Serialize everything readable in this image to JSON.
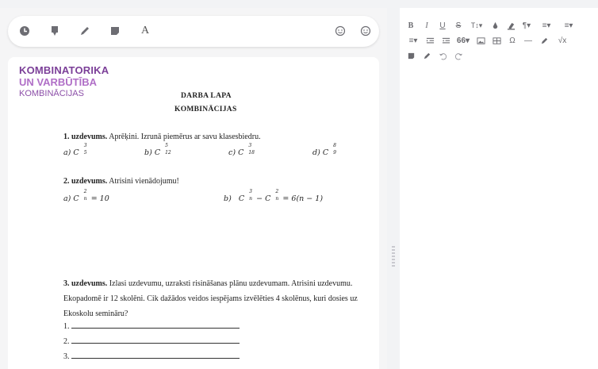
{
  "left_toolbar": {
    "icons": [
      "clock-icon",
      "comment-icon",
      "pencil-icon",
      "note-icon",
      "text-icon",
      "smiley-icon",
      "smiley-alt-icon"
    ],
    "text_label": "A"
  },
  "document": {
    "heading_1": "KOMBINATORIKA",
    "heading_2": "UN VARBŪTĪBA",
    "heading_3": "KOMBINĀCIJAS",
    "worksheet_title": "DARBA LAPA",
    "worksheet_subtitle": "KOMBINĀCIJAS",
    "task1": {
      "label": "1. uzdevums.",
      "text": " Aprēķini. Izrunā piemērus ar savu klasesbiedru.",
      "items": [
        {
          "prefix": "a)",
          "letter": "C",
          "sub": "5",
          "sup": "3"
        },
        {
          "prefix": "b)",
          "letter": "C",
          "sub": "12",
          "sup": "5"
        },
        {
          "prefix": "c)",
          "letter": "C",
          "sub": "18",
          "sup": "3"
        },
        {
          "prefix": "d)",
          "letter": "C",
          "sub": "9",
          "sup": "8"
        }
      ]
    },
    "task2": {
      "label": "2. uzdevums.",
      "text": " Atrisini vienādojumu!",
      "eq_a_prefix": "a)",
      "eq_a_rest": " = 10",
      "eq_b_prefix": "b)",
      "eq_b_rest": " = 6(n − 1)"
    },
    "task3": {
      "label": "3. uzdevums.",
      "text": " Izlasi uzdevumu, uzraksti risināšanas plānu uzdevumam. Atrisini uzdevumu. Ekopadomē ir 12 skolēni. Cik dažādos veidos iespējams izvēlēties 4 skolēnus, kuri dosies uz Ekoskolu semināru?",
      "lines": [
        "1.",
        "2.",
        "3."
      ],
      "ellipsis": "…"
    }
  },
  "right_toolbar": {
    "row1": [
      "B",
      "I",
      "U",
      "S",
      "T↕▾",
      "text-color-icon",
      "highlight-icon",
      "¶▾",
      "align-icon",
      "list-icon"
    ],
    "row2": [
      "list-icon",
      "indent-icon",
      "outdent-icon",
      "66▾",
      "image-icon",
      "table-icon",
      "Ω",
      "—",
      "pencil-icon",
      "√x"
    ],
    "row3": [
      "note-icon",
      "pencil-icon",
      "undo-icon",
      "redo-icon"
    ],
    "labels": {
      "bold": "B",
      "italic": "I",
      "underline": "U",
      "strike": "S",
      "font_size": "T↕▾",
      "paragraph": "¶▾",
      "align": "≡▾",
      "list": "≡▾",
      "list2": "≡▾",
      "quote": "66▾",
      "omega": "Ω",
      "hr": "—",
      "sqrt": "√x"
    }
  }
}
